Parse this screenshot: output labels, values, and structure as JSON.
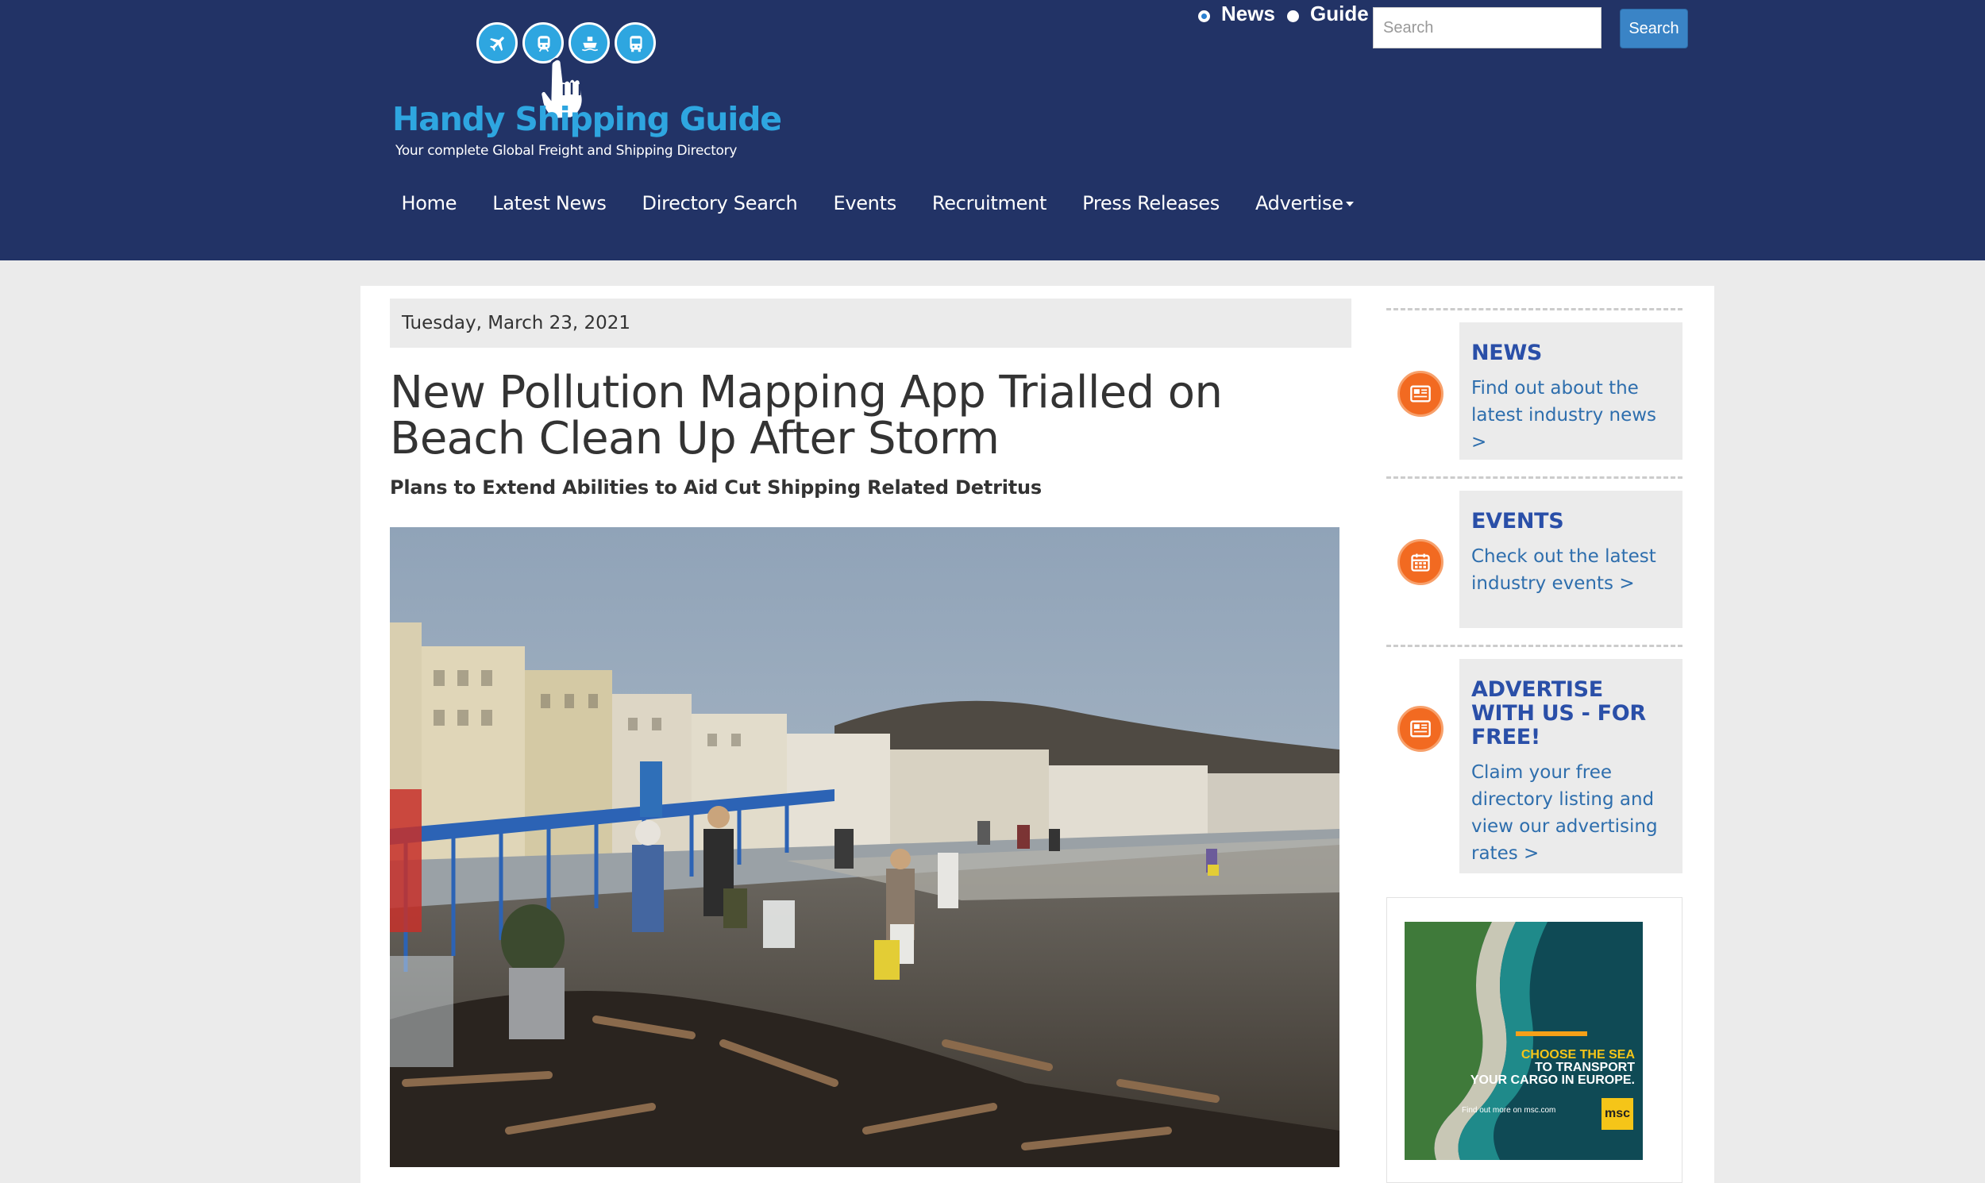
{
  "brand": {
    "name": "Handy Shipping Guide",
    "tagline": "Your complete Global Freight and Shipping Directory",
    "color": "#2ea6e0"
  },
  "search": {
    "options": [
      {
        "label": "News",
        "selected": true
      },
      {
        "label": "Guide",
        "selected": false
      }
    ],
    "placeholder": "Search",
    "button_label": "Search"
  },
  "nav": {
    "items": [
      {
        "label": "Home"
      },
      {
        "label": "Latest News"
      },
      {
        "label": "Directory Search"
      },
      {
        "label": "Events"
      },
      {
        "label": "Recruitment"
      },
      {
        "label": "Press Releases"
      },
      {
        "label": "Advertise",
        "has_dropdown": true
      }
    ]
  },
  "article": {
    "date": "Tuesday, March 23, 2021",
    "title": "New Pollution Mapping App Trialled on Beach Clean Up After Storm",
    "subtitle": "Plans to Extend Abilities to Aid Cut Shipping Related Detritus"
  },
  "sidebar": {
    "blocks": [
      {
        "icon": "newspaper-icon",
        "title": "NEWS",
        "link": "Find out about the latest industry news >"
      },
      {
        "icon": "calendar-icon",
        "title": "EVENTS",
        "link": "Check out the latest industry events >"
      },
      {
        "icon": "newspaper-icon",
        "title": "ADVERTISE WITH US - FOR FREE!",
        "link": "Claim your free directory listing and view our advertising rates >"
      }
    ],
    "ad": {
      "headline_line1": "CHOOSE THE SEA",
      "headline_line2": "TO TRANSPORT",
      "headline_line3": "YOUR CARGO IN EUROPE.",
      "small_text": "Find out more on msc.com",
      "logo_text": "msc"
    }
  },
  "colors": {
    "header_bg": "#223366",
    "accent_orange": "#f26a21",
    "sidebar_title": "#2a4fa8",
    "link": "#2e6ead"
  }
}
